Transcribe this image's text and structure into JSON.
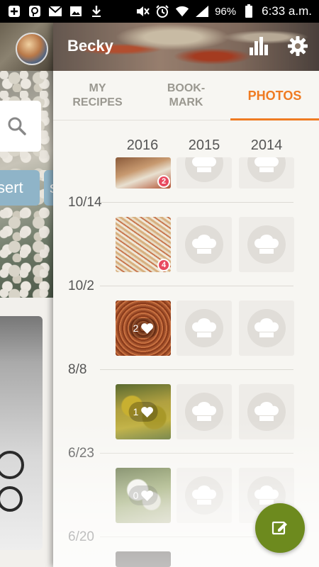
{
  "status_bar": {
    "battery_percent": "96%",
    "time": "6:33 a.m."
  },
  "background_app": {
    "chip_1": "sert",
    "chip_2": "s"
  },
  "drawer": {
    "user_name": "Becky",
    "tabs": [
      {
        "label": "MY\nRECIPES",
        "active": false
      },
      {
        "label": "BOOK-\nMARK",
        "active": false
      },
      {
        "label": "PHOTOS",
        "active": true
      }
    ],
    "years": [
      "2016",
      "2015",
      "2014"
    ],
    "rows": [
      {
        "date": "10/14",
        "photo_2016": {
          "badge": "2"
        }
      },
      {
        "date": "10/2",
        "photo_2016": {
          "badge": "4"
        }
      },
      {
        "date": "8/8",
        "photo_2016": {
          "likes": "2"
        }
      },
      {
        "date": "6/23",
        "photo_2016": {
          "likes": "1"
        }
      },
      {
        "date": "6/20",
        "photo_2016": {
          "likes": "0"
        }
      }
    ]
  },
  "colors": {
    "accent": "#ef7b22",
    "fab": "#6d8a1e",
    "badge": "#e84a5f"
  }
}
